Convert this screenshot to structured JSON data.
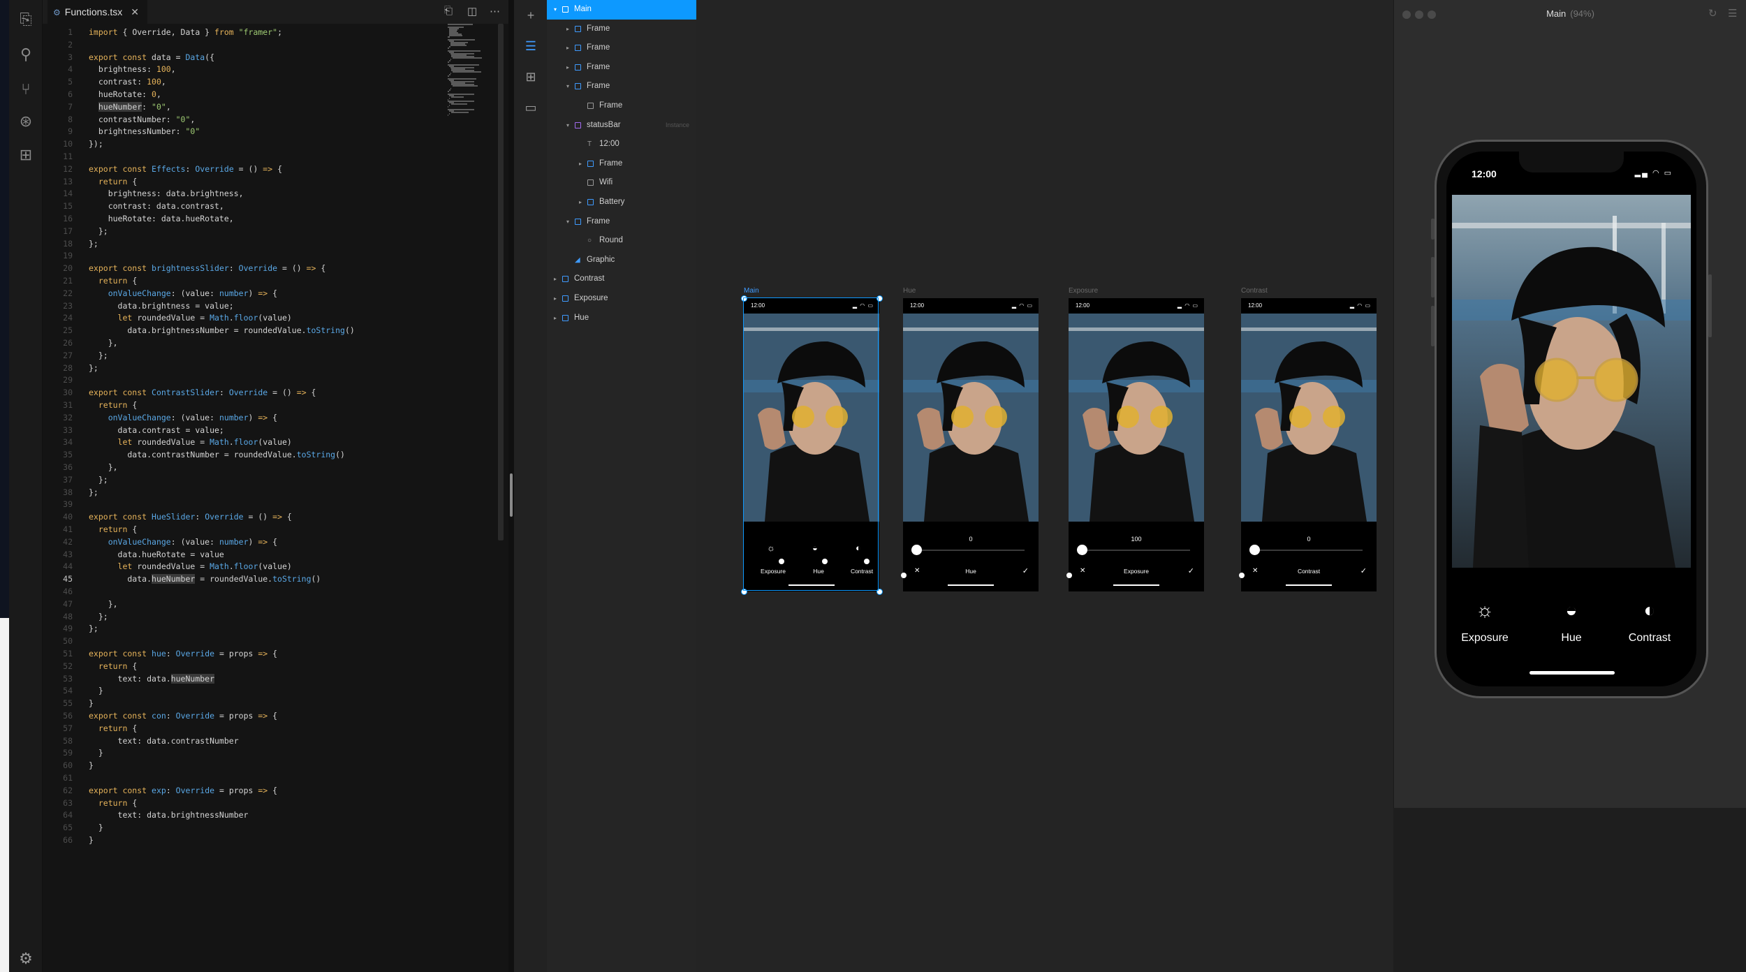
{
  "editor": {
    "tab_label": "Functions.tsx",
    "tab_close": "✕",
    "lines": [
      {
        "n": "1",
        "html": "<span class=\"kw\">import</span> { Override, Data } <span class=\"kw\">from</span> <span class=\"str\">\"framer\"</span>;"
      },
      {
        "n": "2",
        "html": ""
      },
      {
        "n": "3",
        "html": "<span class=\"kw\">export const</span> data = <span class=\"cl\">Data</span>({"
      },
      {
        "n": "4",
        "html": "  brightness: <span class=\"num\">100</span>,"
      },
      {
        "n": "5",
        "html": "  contrast: <span class=\"num\">100</span>,"
      },
      {
        "n": "6",
        "html": "  hueRotate: <span class=\"num\">0</span>,"
      },
      {
        "n": "7",
        "html": "  <span class=\"hl\">hueNumber</span>: <span class=\"str\">\"0\"</span>,"
      },
      {
        "n": "8",
        "html": "  contrastNumber: <span class=\"str\">\"0\"</span>,"
      },
      {
        "n": "9",
        "html": "  brightnessNumber: <span class=\"str\">\"0\"</span>"
      },
      {
        "n": "10",
        "html": "});"
      },
      {
        "n": "11",
        "html": ""
      },
      {
        "n": "12",
        "html": "<span class=\"kw\">export const</span> <span class=\"cl\">Effects</span>: <span class=\"cl\">Override</span> = () <span class=\"kw\">=&gt;</span> {"
      },
      {
        "n": "13",
        "html": "  <span class=\"kw\">return</span> {"
      },
      {
        "n": "14",
        "html": "    brightness: data.brightness,"
      },
      {
        "n": "15",
        "html": "    contrast: data.contrast,"
      },
      {
        "n": "16",
        "html": "    hueRotate: data.hueRotate,"
      },
      {
        "n": "17",
        "html": "  };"
      },
      {
        "n": "18",
        "html": "};"
      },
      {
        "n": "19",
        "html": ""
      },
      {
        "n": "20",
        "html": "<span class=\"kw\">export const</span> <span class=\"cl\">brightnessSlider</span>: <span class=\"cl\">Override</span> = () <span class=\"kw\">=&gt;</span> {"
      },
      {
        "n": "21",
        "html": "  <span class=\"kw\">return</span> {"
      },
      {
        "n": "22",
        "html": "    <span class=\"cl\">onValueChange</span>: (value: <span class=\"cl\">number</span>) <span class=\"kw\">=&gt;</span> {"
      },
      {
        "n": "23",
        "html": "      data.brightness = value;"
      },
      {
        "n": "24",
        "html": "      <span class=\"kw\">let</span> roundedValue = <span class=\"cl\">Math</span>.<span class=\"cl\">floor</span>(value)"
      },
      {
        "n": "25",
        "html": "        data.brightnessNumber = roundedValue.<span class=\"cl\">toString</span>()"
      },
      {
        "n": "26",
        "html": "    },"
      },
      {
        "n": "27",
        "html": "  };"
      },
      {
        "n": "28",
        "html": "};"
      },
      {
        "n": "29",
        "html": ""
      },
      {
        "n": "30",
        "html": "<span class=\"kw\">export const</span> <span class=\"cl\">ContrastSlider</span>: <span class=\"cl\">Override</span> = () <span class=\"kw\">=&gt;</span> {"
      },
      {
        "n": "31",
        "html": "  <span class=\"kw\">return</span> {"
      },
      {
        "n": "32",
        "html": "    <span class=\"cl\">onValueChange</span>: (value: <span class=\"cl\">number</span>) <span class=\"kw\">=&gt;</span> {"
      },
      {
        "n": "33",
        "html": "      data.contrast = value;"
      },
      {
        "n": "34",
        "html": "      <span class=\"kw\">let</span> roundedValue = <span class=\"cl\">Math</span>.<span class=\"cl\">floor</span>(value)"
      },
      {
        "n": "35",
        "html": "        data.contrastNumber = roundedValue.<span class=\"cl\">toString</span>()"
      },
      {
        "n": "36",
        "html": "    },"
      },
      {
        "n": "37",
        "html": "  };"
      },
      {
        "n": "38",
        "html": "};"
      },
      {
        "n": "39",
        "html": ""
      },
      {
        "n": "40",
        "html": "<span class=\"kw\">export const</span> <span class=\"cl\">HueSlider</span>: <span class=\"cl\">Override</span> = () <span class=\"kw\">=&gt;</span> {"
      },
      {
        "n": "41",
        "html": "  <span class=\"kw\">return</span> {"
      },
      {
        "n": "42",
        "html": "    <span class=\"cl\">onValueChange</span>: (value: <span class=\"cl\">number</span>) <span class=\"kw\">=&gt;</span> {"
      },
      {
        "n": "43",
        "html": "      data.hueRotate = value"
      },
      {
        "n": "44",
        "html": "      <span class=\"kw\">let</span> roundedValue = <span class=\"cl\">Math</span>.<span class=\"cl\">floor</span>(value)"
      },
      {
        "n": "45",
        "html": "        data.<span class=\"hl\">hueNumber</span> = roundedValue.<span class=\"cl\">toString</span>()",
        "cur": true
      },
      {
        "n": "46",
        "html": ""
      },
      {
        "n": "47",
        "html": "    },"
      },
      {
        "n": "48",
        "html": "  };"
      },
      {
        "n": "49",
        "html": "};"
      },
      {
        "n": "50",
        "html": ""
      },
      {
        "n": "51",
        "html": "<span class=\"kw\">export const</span> <span class=\"cl\">hue</span>: <span class=\"cl\">Override</span> = props <span class=\"kw\">=&gt;</span> {"
      },
      {
        "n": "52",
        "html": "  <span class=\"kw\">return</span> {"
      },
      {
        "n": "53",
        "html": "      text: data.<span class=\"hl\">hueNumber</span>"
      },
      {
        "n": "54",
        "html": "  }"
      },
      {
        "n": "55",
        "html": "}"
      },
      {
        "n": "56",
        "html": "<span class=\"kw\">export const</span> <span class=\"cl\">con</span>: <span class=\"cl\">Override</span> = props <span class=\"kw\">=&gt;</span> {"
      },
      {
        "n": "57",
        "html": "  <span class=\"kw\">return</span> {"
      },
      {
        "n": "58",
        "html": "      text: data.contrastNumber"
      },
      {
        "n": "59",
        "html": "  }"
      },
      {
        "n": "60",
        "html": "}"
      },
      {
        "n": "61",
        "html": ""
      },
      {
        "n": "62",
        "html": "<span class=\"kw\">export const</span> <span class=\"cl\">exp</span>: <span class=\"cl\">Override</span> = props <span class=\"kw\">=&gt;</span> {"
      },
      {
        "n": "63",
        "html": "  <span class=\"kw\">return</span> {"
      },
      {
        "n": "64",
        "html": "      text: data.brightnessNumber"
      },
      {
        "n": "65",
        "html": "  }"
      },
      {
        "n": "66",
        "html": "}"
      }
    ]
  },
  "layers": [
    {
      "name": "Main",
      "depth": 0,
      "arrow": "▾",
      "icon": "frame",
      "selected": true
    },
    {
      "name": "Frame",
      "depth": 1,
      "arrow": "▸",
      "icon": "frame"
    },
    {
      "name": "Frame",
      "depth": 1,
      "arrow": "▸",
      "icon": "frame"
    },
    {
      "name": "Frame",
      "depth": 1,
      "arrow": "▸",
      "icon": "frame"
    },
    {
      "name": "Frame",
      "depth": 1,
      "arrow": "▾",
      "icon": "frame"
    },
    {
      "name": "Frame",
      "depth": 2,
      "arrow": "",
      "icon": "grey"
    },
    {
      "name": "statusBar",
      "depth": 1,
      "arrow": "▾",
      "icon": "purple",
      "tag": "Instance"
    },
    {
      "name": "12:00",
      "depth": 2,
      "arrow": "",
      "icon": "text"
    },
    {
      "name": "Frame",
      "depth": 2,
      "arrow": "▸",
      "icon": "frame"
    },
    {
      "name": "Wifi",
      "depth": 2,
      "arrow": "",
      "icon": "grey"
    },
    {
      "name": "Battery",
      "depth": 2,
      "arrow": "▸",
      "icon": "frame"
    },
    {
      "name": "Frame",
      "depth": 1,
      "arrow": "▾",
      "icon": "frame"
    },
    {
      "name": "Round",
      "depth": 2,
      "arrow": "",
      "icon": "circle"
    },
    {
      "name": "Graphic",
      "depth": 1,
      "arrow": "",
      "icon": "graphic"
    },
    {
      "name": "Contrast",
      "depth": 0,
      "arrow": "▸",
      "icon": "frame"
    },
    {
      "name": "Exposure",
      "depth": 0,
      "arrow": "▸",
      "icon": "frame"
    },
    {
      "name": "Hue",
      "depth": 0,
      "arrow": "▸",
      "icon": "frame"
    }
  ],
  "canvas": {
    "frames": [
      {
        "label": "Main",
        "type": "main",
        "time": "12:00",
        "controls": [
          "Exposure",
          "Hue",
          "Contrast"
        ]
      },
      {
        "label": "Hue",
        "type": "slider",
        "time": "12:00",
        "value": "0",
        "name": "Hue",
        "slider": 0.0
      },
      {
        "label": "Exposure",
        "type": "slider",
        "time": "12:00",
        "value": "100",
        "name": "Exposure",
        "slider": 0.0
      },
      {
        "label": "Contrast",
        "type": "slider",
        "time": "12:00",
        "value": "0",
        "name": "Contrast",
        "slider": 0.0
      }
    ],
    "close_glyph": "✕",
    "check_glyph": "✓"
  },
  "preview": {
    "title": "Main",
    "zoom": "(94%)",
    "phone_time": "12:00",
    "controls": [
      {
        "label": "Exposure",
        "icon": "sun-icon",
        "glyph": "☼"
      },
      {
        "label": "Hue",
        "icon": "hue-drop-icon",
        "glyph": "◒"
      },
      {
        "label": "Contrast",
        "icon": "contrast-icon",
        "glyph": "◐"
      }
    ]
  },
  "colors": {
    "selection": "#0d99ff",
    "keyword": "#e6b35a",
    "identifier": "#5aa8e6",
    "string": "#9fcb73"
  }
}
